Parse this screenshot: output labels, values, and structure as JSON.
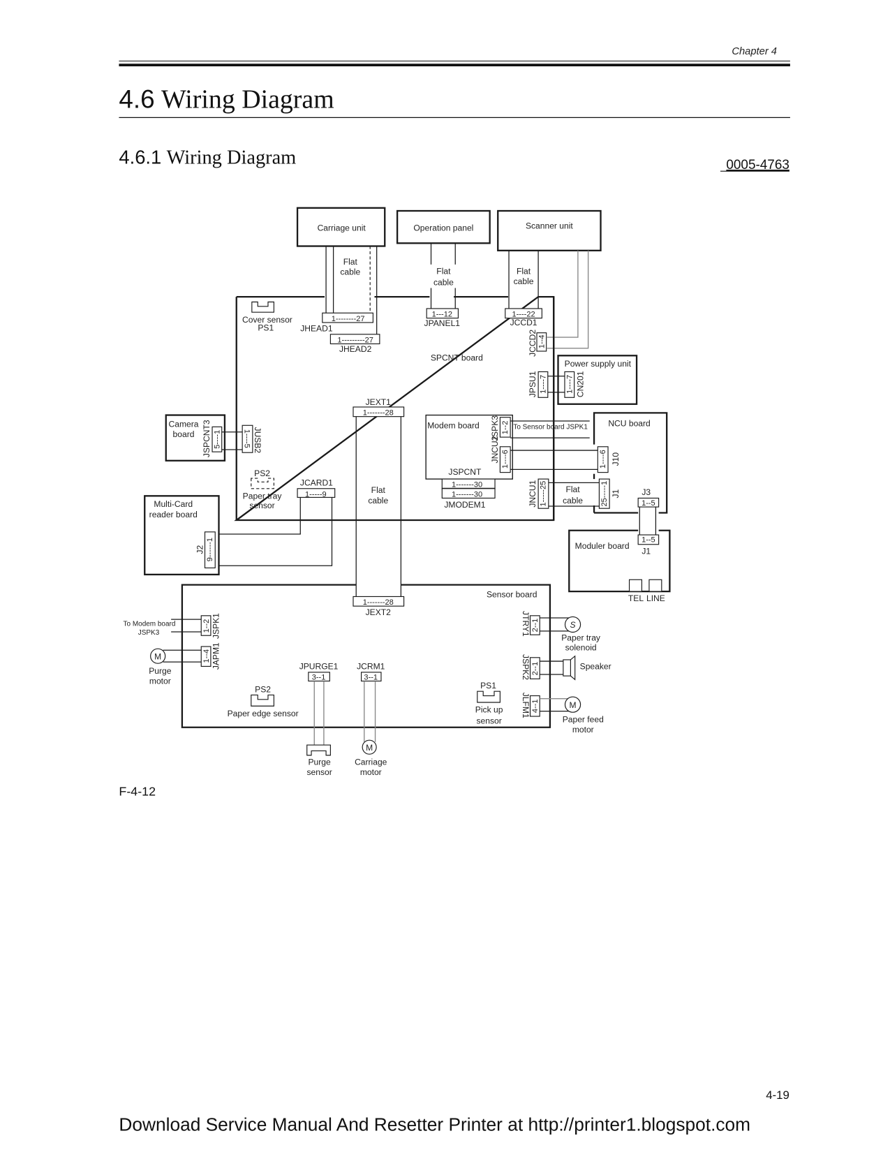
{
  "header": {
    "chapter": "Chapter 4",
    "section_title": "4.6 Wiring Diagram",
    "section_number": "4.6",
    "section_name": "Wiring Diagram",
    "subsection_number": "4.6.1",
    "subsection_name": "Wiring Diagram",
    "doc_id": "0005-4763"
  },
  "diagram": {
    "units": {
      "carriage": "Carriage unit",
      "operation": "Operation panel",
      "scanner": "Scanner unit",
      "power": "Power supply unit",
      "camera": "Camera\nboard",
      "camera_l1": "Camera",
      "camera_l2": "board",
      "multicard_l1": "Multi-Card",
      "multicard_l2": "reader board",
      "modem": "Modem board",
      "ncu": "NCU board",
      "moduler": "Moduler board",
      "spcnt": "SPCNT board",
      "sensor": "Sensor board"
    },
    "cables": {
      "flat_l1": "Flat",
      "flat_l2": "cable"
    },
    "connectors": {
      "jhead1": {
        "name": "JHEAD1",
        "pins": "1--------27"
      },
      "jhead2": {
        "name": "JHEAD2",
        "pins": "1---------27"
      },
      "jpanel1": {
        "name": "JPANEL1",
        "pins": "1---12"
      },
      "jccd1": {
        "name": "JCCD1",
        "pins": "1----22"
      },
      "jccd2": {
        "name": "JCCD2",
        "pins": "1--4"
      },
      "jpsu1": {
        "name": "JPSU1",
        "pins": "1----7"
      },
      "cn201": {
        "name": "CN201",
        "pins": "1----7"
      },
      "jext1": {
        "name": "JEXT1",
        "pins": "1-------28"
      },
      "jext2": {
        "name": "JEXT2",
        "pins": "1-------28"
      },
      "jspcnt3": {
        "name": "JSPCNT3",
        "pins": "5----1"
      },
      "jusb2": {
        "name": "JUSB2",
        "pins": "1----5"
      },
      "jcard1": {
        "name": "JCARD1",
        "pins": "1-----9"
      },
      "j2": {
        "name": "J2",
        "pins": "9------1"
      },
      "jspk3": {
        "name": "JSPK3",
        "pins": "1--2"
      },
      "jncu2": {
        "name": "JNCU2",
        "pins": "1----6"
      },
      "jspcnt": {
        "name": "JSPCNT",
        "pins": "1-------30"
      },
      "jmodem1": {
        "name": "JMODEM1",
        "pins": "1-------30"
      },
      "jncu1": {
        "name": "JNCU1",
        "pins": "1-----25"
      },
      "j10": {
        "name": "J10",
        "pins": "1----6"
      },
      "j1_ncu": {
        "name": "J1",
        "pins": "25-----1"
      },
      "j3": {
        "name": "J3",
        "pins": "1--5"
      },
      "j1_mod": {
        "name": "J1",
        "pins": "1--5"
      },
      "jspk1": {
        "name": "JSPK1",
        "pins": "1--2"
      },
      "japm1": {
        "name": "JAPM1",
        "pins": "1--4"
      },
      "jpurge1": {
        "name": "JPURGE1",
        "pins": "3--1"
      },
      "jcrm1": {
        "name": "JCRM1",
        "pins": "3--1"
      },
      "jtry1": {
        "name": "JTRY1",
        "pins": "2--1"
      },
      "jspk2": {
        "name": "JSPK2",
        "pins": "2--1"
      },
      "jlfm1": {
        "name": "JLFM1",
        "pins": "4--1"
      }
    },
    "sensors": {
      "cover_l1": "Cover sensor",
      "cover_l2": "PS1",
      "ps2_top": "PS2",
      "paper_tray_l1": "Paper tray",
      "paper_tray_l2": "sensor",
      "ps2_bottom": "PS2",
      "paper_edge": "Paper edge sensor",
      "ps1_bottom": "PS1",
      "pickup_l1": "Pick up",
      "pickup_l2": "sensor",
      "purge_sensor_l1": "Purge",
      "purge_sensor_l2": "sensor"
    },
    "devices": {
      "motor_symbol": "M",
      "solenoid_symbol": "S",
      "purge_motor_l1": "Purge",
      "purge_motor_l2": "motor",
      "carriage_motor_l1": "Carriage",
      "carriage_motor_l2": "motor",
      "paper_tray_solenoid_l1": "Paper tray",
      "paper_tray_solenoid_l2": "solenoid",
      "speaker": "Speaker",
      "paper_feed_motor_l1": "Paper feed",
      "paper_feed_motor_l2": "motor"
    },
    "notes": {
      "to_sensor_board": "To Sensor board JSPK1",
      "to_modem_l1": "To Modem board",
      "to_modem_l2": "JSPK3",
      "tel": "TEL",
      "line": "LINE"
    },
    "figure_id": "F-4-12"
  },
  "footer": {
    "page_number": "4-19",
    "banner": "Download Service Manual And Resetter Printer at http://printer1.blogspot.com"
  }
}
